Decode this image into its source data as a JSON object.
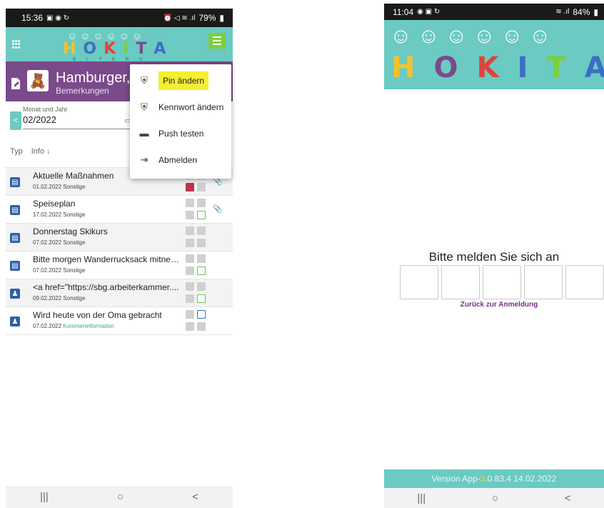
{
  "left": {
    "status": {
      "time": "15:36",
      "battery": "79%"
    },
    "logo": {
      "letters": [
        "H",
        "O",
        "K",
        "I",
        "T",
        "A"
      ],
      "colors": [
        "#f2c230",
        "#3b6fc4",
        "#e0433a",
        "#7bd03a",
        "#7a4a8a",
        "#3b6fc4"
      ],
      "sub": [
        "E",
        "L",
        "T",
        "E",
        "R",
        "N"
      ]
    },
    "child": {
      "name": "Hamburger, P",
      "subtitle": "Bemerkungen"
    },
    "filter": {
      "label": "Monat und Jahr",
      "value": "02/2022"
    },
    "columns": {
      "type": "Typ",
      "info": "Info"
    },
    "menu": [
      {
        "label": "Pin ändern",
        "icon": "shield-user-icon",
        "highlighted": true
      },
      {
        "label": "Kennwort ändern",
        "icon": "shield-icon",
        "highlighted": false
      },
      {
        "label": "Push testen",
        "icon": "chat-icon",
        "highlighted": false
      },
      {
        "label": "Abmelden",
        "icon": "logout-icon",
        "highlighted": false
      }
    ],
    "rows": [
      {
        "title": "Aktuelle Maßnahmen",
        "date": "01.02.2022",
        "category": "Sonstige",
        "attachment": true
      },
      {
        "title": "Speiseplan",
        "date": "17.02.2022",
        "category": "Sonstige",
        "attachment": true
      },
      {
        "title": "Donnerstag Skikurs",
        "date": "07.02.2022",
        "category": "Sonstige",
        "attachment": false
      },
      {
        "title": "Bitte morgen Wanderrucksack mitneh...",
        "date": "07.02.2022",
        "category": "Sonstige",
        "attachment": false
      },
      {
        "title": "<a href=\"https://sbg.arbeiterkammer....",
        "date": "09.02.2022",
        "category": "Sonstige",
        "attachment": false
      },
      {
        "title": "Wird heute von der Oma gebracht",
        "date": "07.02.2022",
        "category": "Kommeninformation",
        "attachment": false
      }
    ]
  },
  "right": {
    "status": {
      "time": "11:04",
      "battery": "84%"
    },
    "logo": {
      "letters": [
        "H",
        "O",
        "K",
        "I",
        "T",
        "A"
      ],
      "colors": [
        "#f2c230",
        "#7a4a8a",
        "#e0433a",
        "#3b6fc4",
        "#7bd03a",
        "#3b6fc4"
      ]
    },
    "login": {
      "title": "Bitte melden Sie sich an",
      "back_link": "Zurück zur Anmeldung"
    },
    "version": {
      "prefix": "Version App- ",
      "highlight": "3",
      "rest": ".0.83.4 14.02.2022"
    }
  },
  "nav": {
    "recent": "|||",
    "home": "○",
    "back": "<"
  }
}
